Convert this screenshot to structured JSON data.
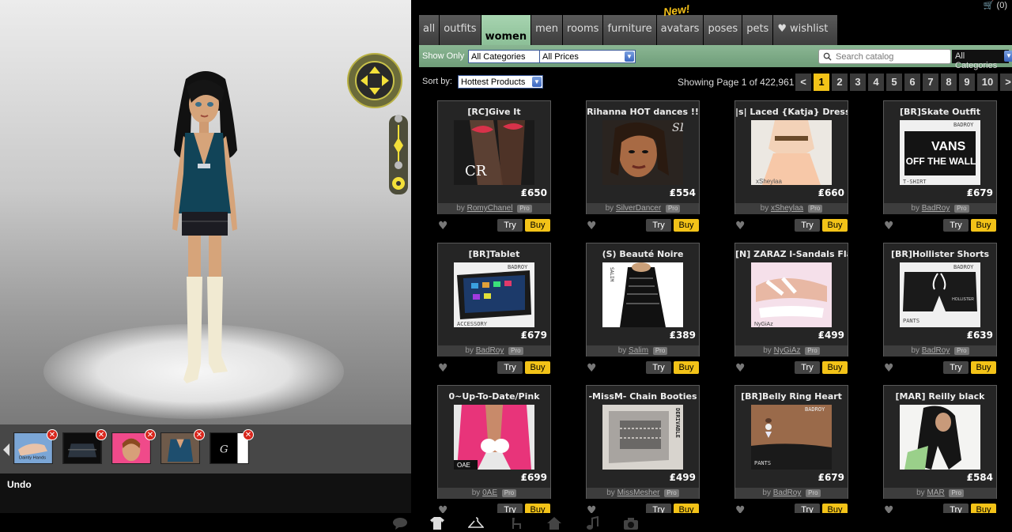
{
  "cart": {
    "count": "(0)"
  },
  "tabs": [
    {
      "label": "all",
      "active": false
    },
    {
      "label": "outfits",
      "active": false
    },
    {
      "label": "women",
      "active": true
    },
    {
      "label": "men",
      "active": false
    },
    {
      "label": "rooms",
      "active": false
    },
    {
      "label": "furniture",
      "active": false
    },
    {
      "label": "avatars",
      "active": false,
      "badge": "New!"
    },
    {
      "label": "poses",
      "active": false
    },
    {
      "label": "pets",
      "active": false
    },
    {
      "label": "wishlist",
      "active": false,
      "icon": "heart-icon"
    }
  ],
  "filters": {
    "show_only": "Show Only",
    "category": "All Categories",
    "price": "All Prices",
    "search_placeholder": "Search catalog",
    "search_category": "All Categories"
  },
  "sort": {
    "label": "Sort by:",
    "value": "Hottest Products",
    "page_info": "Showing Page 1 of 422,961"
  },
  "pager": {
    "prev": "<",
    "next": ">",
    "pages": [
      "1",
      "2",
      "3",
      "4",
      "5",
      "6",
      "7",
      "8",
      "9",
      "10"
    ],
    "current": "1"
  },
  "products": [
    {
      "title": "[RC]Give It",
      "price": "₤650",
      "creator": "RomyChanel",
      "pro": "Pro",
      "thumb": "stockings"
    },
    {
      "title": "Rihanna HOT dances !!",
      "price": "₤554",
      "creator": "SilverDancer",
      "pro": "Pro",
      "thumb": "face"
    },
    {
      "title": "|s| Laced {Katja} Dress",
      "price": "₤660",
      "creator": "xSheylaa",
      "pro": "Pro",
      "thumb": "dress"
    },
    {
      "title": "[BR]Skate Outfit",
      "price": "₤679",
      "creator": "BadRoy",
      "pro": "Pro",
      "thumb": "tshirt"
    },
    {
      "title": "[BR]Tablet",
      "price": "₤679",
      "creator": "BadRoy",
      "pro": "Pro",
      "thumb": "tablet"
    },
    {
      "title": "(S) Beauté Noire",
      "price": "₤389",
      "creator": "Salim",
      "pro": "Pro",
      "thumb": "noire"
    },
    {
      "title": "[N] ZARAZ l-Sandals Flat",
      "price": "₤499",
      "creator": "NyGiAz",
      "pro": "Pro",
      "thumb": "sandals"
    },
    {
      "title": "[BR]Hollister Shorts",
      "price": "₤639",
      "creator": "BadRoy",
      "pro": "Pro",
      "thumb": "shorts"
    },
    {
      "title": "0~Up-To-Date/Pink",
      "price": "₤699",
      "creator": "0AE",
      "pro": "Pro",
      "thumb": "pink"
    },
    {
      "title": "-MissM- Chain Booties",
      "price": "₤499",
      "creator": "MissMesher",
      "pro": "Pro",
      "thumb": "booties"
    },
    {
      "title": "[BR]Belly Ring Heart",
      "price": "₤679",
      "creator": "BadRoy",
      "pro": "Pro",
      "thumb": "belly"
    },
    {
      "title": "[MAR] Reilly black",
      "price": "₤584",
      "creator": "MAR",
      "pro": "Pro",
      "thumb": "hair"
    }
  ],
  "card_labels": {
    "by": "by",
    "try": "Try",
    "buy": "Buy"
  },
  "tray": {
    "items": [
      "hand",
      "skirt",
      "face",
      "top",
      "logo"
    ],
    "remove": "✕"
  },
  "undo": "Undo",
  "thumb_texts": {
    "stockings": "CR",
    "face": "SD",
    "dress": "xSheylaa",
    "tshirt_brand": "BADROY",
    "tshirt_top": "VANS",
    "tshirt_bottom": "OFF THE WALL",
    "tshirt_label": "T-SHIRT",
    "tablet_brand": "BADROY",
    "tablet_label": "ACCESSORY",
    "noire": "SALIM",
    "sandals": "NyGiAz",
    "shorts_brand": "BADROY",
    "shorts_text": "HOLLISTER",
    "shorts_label": "PANTS",
    "pink_label": "OAE",
    "booties": "DERIVABLE",
    "belly_brand": "BADROY",
    "belly_label": "PANTS",
    "tray_hand": "Dainty Hands",
    "tray_logo": "G"
  },
  "colors": {
    "accent_yellow": "#f3c318",
    "tab_active": "#8cbf97",
    "filter_green": "#7aa884",
    "remove_red": "#d9261c"
  },
  "dock": [
    "chat-icon",
    "shirt-icon",
    "hanger-icon",
    "chair-icon",
    "home-icon",
    "music-icon",
    "camera-icon"
  ]
}
